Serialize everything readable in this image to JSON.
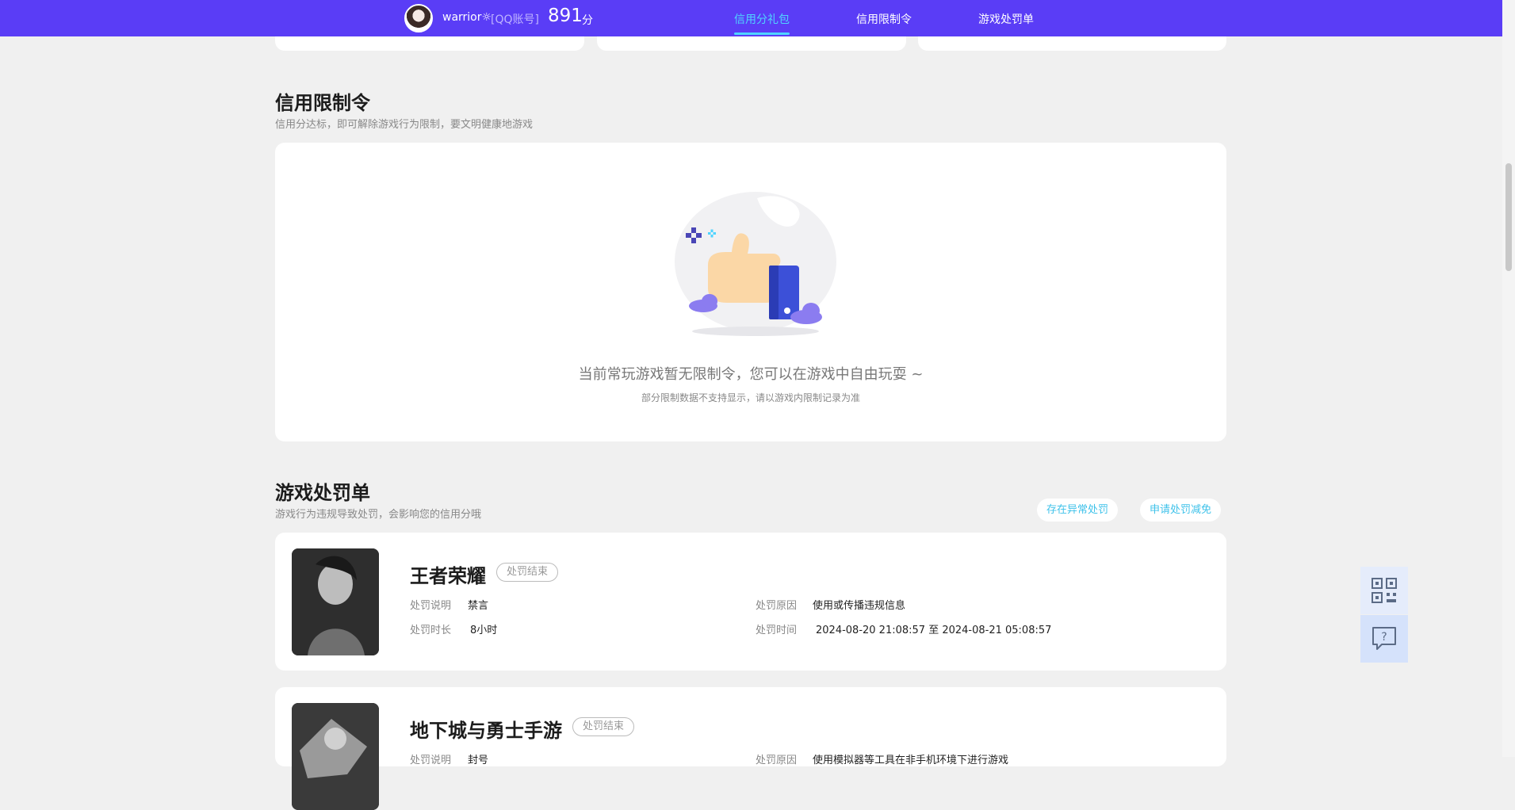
{
  "header": {
    "nickname": "warrior☼",
    "account_type": "[QQ账号]",
    "score": "891",
    "score_unit": "分",
    "tabs": [
      {
        "label": "信用分礼包",
        "active": true
      },
      {
        "label": "信用限制令",
        "active": false
      },
      {
        "label": "游戏处罚单",
        "active": false
      }
    ],
    "bg_color": "#5a3df6",
    "active_color": "#4fd4ff"
  },
  "restriction": {
    "title": "信用限制令",
    "subtitle": "信用分达标，即可解除游戏行为限制，要文明健康地游戏",
    "empty_message": "当前常玩游戏暂无限制令，您可以在游戏中自由玩耍 ~",
    "empty_note": "部分限制数据不支持显示，请以游戏内限制记录为准"
  },
  "penalties": {
    "title": "游戏处罚单",
    "subtitle": "游戏行为违规导致处罚，会影响您的信用分哦",
    "abnormal_button": "存在异常处罚",
    "appeal_button": "申请处罚减免",
    "records": [
      {
        "game": "王者荣耀",
        "status": "处罚结束",
        "desc_label": "处罚说明",
        "desc": "禁言",
        "duration_label": "处罚时长",
        "duration": "8小时",
        "reason_label": "处罚原因",
        "reason": "使用或传播违规信息",
        "time_label": "处罚时间",
        "time": "2024-08-20 21:08:57 至 2024-08-21 05:08:57"
      },
      {
        "game": "地下城与勇士手游",
        "status": "处罚结束",
        "desc_label": "处罚说明",
        "desc": "封号",
        "reason_label": "处罚原因",
        "reason": "使用模拟器等工具在非手机环境下进行游戏"
      }
    ]
  },
  "floating": {
    "qr_icon": "qr-code-icon",
    "help_icon": "help-chat-icon"
  }
}
